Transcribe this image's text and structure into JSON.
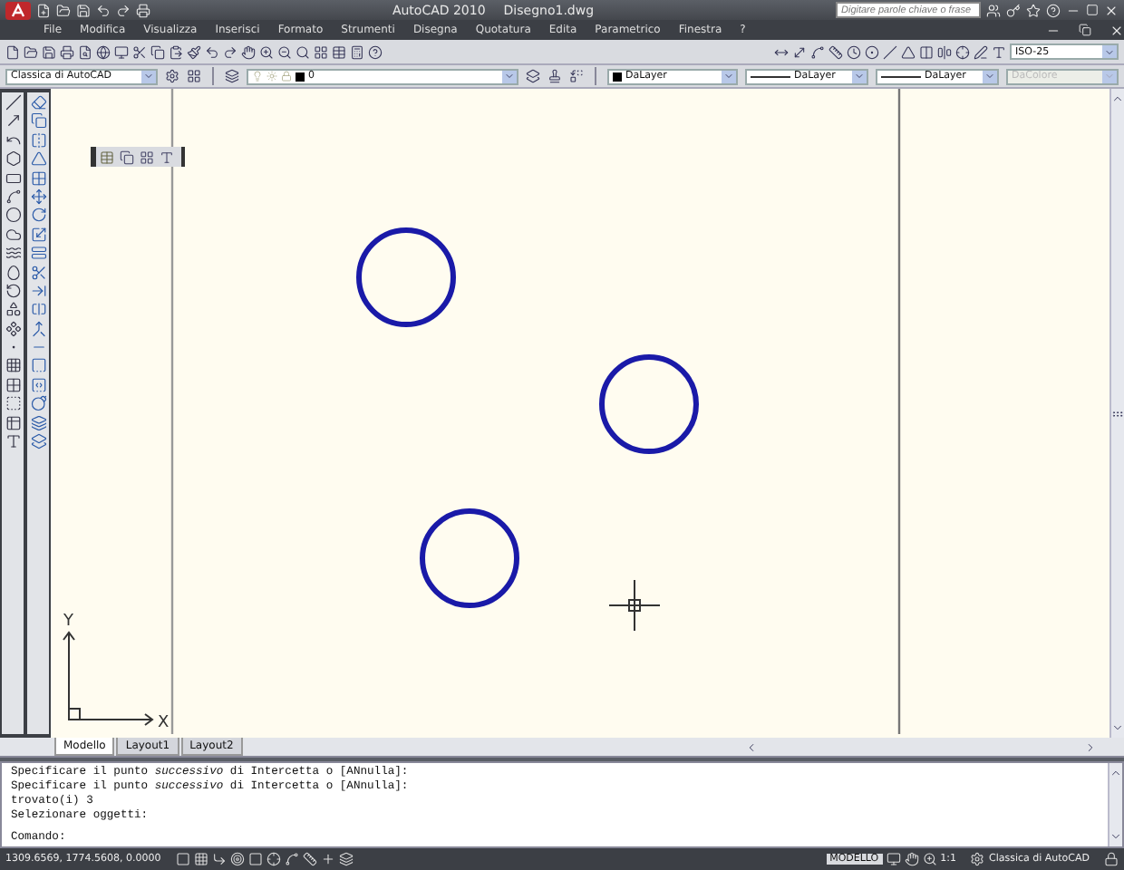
{
  "window": {
    "app_title": "AutoCAD 2010",
    "document": "Disegno1.dwg"
  },
  "search": {
    "placeholder": "Digitare parole chiave o frase"
  },
  "menu": [
    "File",
    "Modifica",
    "Visualizza",
    "Inserisci",
    "Formato",
    "Strumenti",
    "Disegna",
    "Quotatura",
    "Edita",
    "Parametrico",
    "Finestra",
    "?"
  ],
  "dim_style": "ISO-25",
  "workspace": "Classica di AutoCAD",
  "layer": "0",
  "properties": [
    {
      "value": "DaLayer",
      "kind": "color",
      "disabled": false
    },
    {
      "value": "DaLayer",
      "kind": "linetype",
      "disabled": false
    },
    {
      "value": "DaLayer",
      "kind": "lineweight",
      "disabled": false
    },
    {
      "value": "DaColore",
      "kind": "plotstyle",
      "disabled": true
    }
  ],
  "ucs": {
    "y": "Y",
    "x": "X"
  },
  "tabs": [
    {
      "label": "Modello",
      "selected": true
    },
    {
      "label": "Layout1",
      "selected": false
    },
    {
      "label": "Layout2",
      "selected": false
    }
  ],
  "command_lines": [
    "Specificare il punto *successivo* di Intercetta o [ANnulla]:",
    "Specificare il punto *successivo* di Intercetta o [ANnulla]:",
    "trovato(i) 3",
    "Selezionare oggetti:"
  ],
  "command_prompt": "Comando:",
  "status": {
    "coordinates": "1309.6569, 1774.5608, 0.0000",
    "space": "MODELLO",
    "scale": "1:1",
    "workspace": "Classica di AutoCAD"
  }
}
